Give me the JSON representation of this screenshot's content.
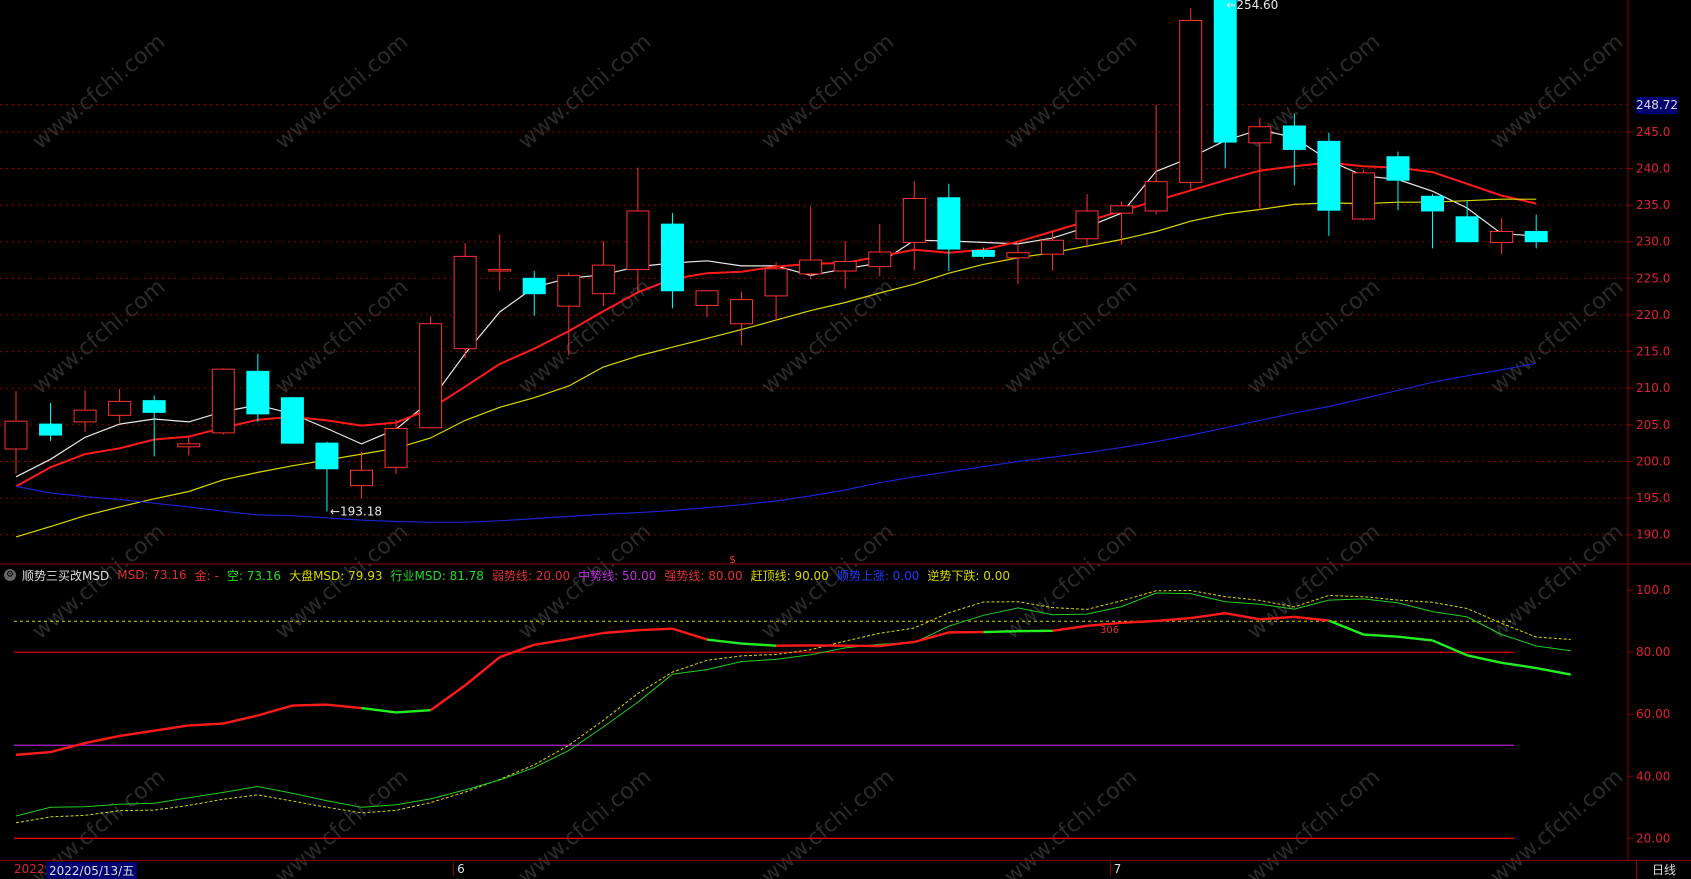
{
  "chart_data": [
    {
      "type": "candlestick",
      "panel": "main-price",
      "ylim": [
        186,
        263
      ],
      "yticks": [
        "190.0",
        "195.0",
        "200.0",
        "205.0",
        "210.0",
        "215.0",
        "220.0",
        "225.0",
        "230.0",
        "235.0",
        "240.0",
        "245.0"
      ],
      "current_price": "248.72",
      "high_annotation": "254.60",
      "low_annotation": "193.18",
      "candles": [
        {
          "o": 201.7,
          "h": 209.6,
          "l": 198.3,
          "c": 205.5
        },
        {
          "o": 205.1,
          "h": 208.0,
          "l": 202.8,
          "c": 203.6
        },
        {
          "o": 205.4,
          "h": 209.7,
          "l": 204.0,
          "c": 207.0
        },
        {
          "o": 206.3,
          "h": 209.9,
          "l": 205.3,
          "c": 208.2
        },
        {
          "o": 208.3,
          "h": 209.0,
          "l": 200.7,
          "c": 206.7
        },
        {
          "o": 202.0,
          "h": 203.3,
          "l": 200.8,
          "c": 202.4
        },
        {
          "o": 203.9,
          "h": 212.7,
          "l": 203.7,
          "c": 212.6
        },
        {
          "o": 212.3,
          "h": 214.7,
          "l": 205.4,
          "c": 206.5
        },
        {
          "o": 208.7,
          "h": 208.8,
          "l": 202.4,
          "c": 202.5
        },
        {
          "o": 202.5,
          "h": 202.7,
          "l": 193.18,
          "c": 199.0
        },
        {
          "o": 196.7,
          "h": 201.3,
          "l": 195.0,
          "c": 198.8
        },
        {
          "o": 199.2,
          "h": 205.7,
          "l": 198.3,
          "c": 204.5
        },
        {
          "o": 204.6,
          "h": 219.8,
          "l": 204.5,
          "c": 218.8
        },
        {
          "o": 215.4,
          "h": 229.8,
          "l": 214.1,
          "c": 228.0
        },
        {
          "o": 226.2,
          "h": 231.0,
          "l": 223.3,
          "c": 226.2
        },
        {
          "o": 225.0,
          "h": 226.0,
          "l": 219.9,
          "c": 222.9
        },
        {
          "o": 221.2,
          "h": 225.8,
          "l": 214.5,
          "c": 225.4
        },
        {
          "o": 222.9,
          "h": 230.1,
          "l": 221.2,
          "c": 226.8
        },
        {
          "o": 226.2,
          "h": 240.1,
          "l": 222.9,
          "c": 234.2
        },
        {
          "o": 232.4,
          "h": 233.9,
          "l": 220.9,
          "c": 223.3
        },
        {
          "o": 221.3,
          "h": 223.4,
          "l": 219.7,
          "c": 223.3
        },
        {
          "o": 218.8,
          "h": 223.2,
          "l": 215.9,
          "c": 222.1
        },
        {
          "o": 222.6,
          "h": 227.2,
          "l": 219.2,
          "c": 226.3
        },
        {
          "o": 225.6,
          "h": 234.8,
          "l": 224.9,
          "c": 227.5
        },
        {
          "o": 226.0,
          "h": 230.1,
          "l": 223.6,
          "c": 227.3
        },
        {
          "o": 226.6,
          "h": 232.4,
          "l": 225.3,
          "c": 228.6
        },
        {
          "o": 229.9,
          "h": 238.3,
          "l": 226.1,
          "c": 235.9
        },
        {
          "o": 236.0,
          "h": 237.9,
          "l": 226.0,
          "c": 229.0
        },
        {
          "o": 228.8,
          "h": 229.2,
          "l": 227.7,
          "c": 228.0
        },
        {
          "o": 227.8,
          "h": 229.8,
          "l": 224.2,
          "c": 228.5
        },
        {
          "o": 228.3,
          "h": 231.4,
          "l": 226.1,
          "c": 230.2
        },
        {
          "o": 230.4,
          "h": 236.5,
          "l": 229.2,
          "c": 234.2
        },
        {
          "o": 233.9,
          "h": 235.5,
          "l": 229.6,
          "c": 234.9
        },
        {
          "o": 234.2,
          "h": 248.7,
          "l": 233.7,
          "c": 238.2
        },
        {
          "o": 238.1,
          "h": 261.9,
          "l": 236.9,
          "c": 260.2
        },
        {
          "o": 263.0,
          "h": 263.0,
          "l": 240.1,
          "c": 243.6
        },
        {
          "o": 243.5,
          "h": 246.9,
          "l": 234.3,
          "c": 245.7
        },
        {
          "o": 245.8,
          "h": 247.5,
          "l": 237.7,
          "c": 242.6
        },
        {
          "o": 243.7,
          "h": 244.9,
          "l": 230.8,
          "c": 234.3
        },
        {
          "o": 233.1,
          "h": 239.8,
          "l": 232.9,
          "c": 239.4
        },
        {
          "o": 241.6,
          "h": 242.3,
          "l": 234.3,
          "c": 238.4
        },
        {
          "o": 236.2,
          "h": 236.5,
          "l": 229.1,
          "c": 234.2
        },
        {
          "o": 233.4,
          "h": 235.6,
          "l": 229.9,
          "c": 230.0
        },
        {
          "o": 229.9,
          "h": 233.2,
          "l": 228.3,
          "c": 231.4
        },
        {
          "o": 231.4,
          "h": 233.7,
          "l": 229.1,
          "c": 230.0
        }
      ],
      "series": [
        {
          "name": "MA-white",
          "color": "#e8e8e8",
          "values": [
            197.9,
            200.3,
            203.3,
            205.1,
            205.8,
            205.4,
            206.8,
            207.7,
            206.5,
            204.5,
            202.4,
            204.4,
            208.3,
            214.7,
            220.4,
            223.8,
            225.0,
            225.5,
            226.6,
            227.1,
            227.4,
            226.7,
            226.7,
            225.4,
            226.3,
            227.1,
            230.2,
            230.1,
            229.9,
            229.7,
            230.5,
            232.0,
            233.9,
            239.6,
            241.5,
            243.8,
            245.3,
            244.2,
            241.1,
            239.0,
            238.5,
            236.9,
            234.6,
            231.1,
            230.8
          ]
        },
        {
          "name": "MA-red",
          "color": "#ff1a1a",
          "values": [
            196.6,
            199.2,
            201.0,
            201.8,
            203.0,
            203.4,
            204.6,
            205.7,
            206.1,
            205.6,
            204.9,
            205.3,
            207.2,
            210.2,
            213.3,
            215.4,
            217.8,
            220.5,
            223.1,
            224.9,
            225.7,
            225.9,
            226.6,
            227.0,
            227.1,
            228.0,
            228.9,
            228.5,
            228.9,
            230.0,
            231.4,
            232.8,
            234.2,
            235.6,
            237.0,
            238.4,
            239.7,
            240.3,
            240.8,
            240.3,
            240.1,
            239.5,
            237.9,
            236.3,
            235.2
          ]
        },
        {
          "name": "MA-yellow",
          "color": "#d8d800",
          "values": [
            189.7,
            191.1,
            192.6,
            193.8,
            194.9,
            195.9,
            197.5,
            198.5,
            199.4,
            200.2,
            201.0,
            201.8,
            203.2,
            205.6,
            207.4,
            208.7,
            210.3,
            212.9,
            214.4,
            215.6,
            216.8,
            218.0,
            219.3,
            220.6,
            221.7,
            223.0,
            224.2,
            225.7,
            226.9,
            227.8,
            228.5,
            229.4,
            230.3,
            231.4,
            232.8,
            233.8,
            234.4,
            235.1,
            235.3,
            235.2,
            235.4,
            235.4,
            235.6,
            235.8,
            235.8
          ]
        },
        {
          "name": "MA-blue",
          "color": "#1a22cc",
          "values": [
            196.6,
            195.7,
            195.2,
            194.8,
            194.3,
            193.8,
            193.2,
            192.7,
            192.6,
            192.3,
            192.0,
            191.8,
            191.7,
            191.7,
            191.9,
            192.2,
            192.5,
            192.8,
            193.0,
            193.3,
            193.7,
            194.1,
            194.6,
            195.3,
            196.1,
            197.1,
            197.9,
            198.6,
            199.3,
            200.0,
            200.6,
            201.2,
            201.9,
            202.7,
            203.6,
            204.6,
            205.6,
            206.6,
            207.5,
            208.6,
            209.7,
            210.8,
            211.7,
            212.5,
            213.4
          ]
        }
      ]
    },
    {
      "type": "line",
      "panel": "indicator",
      "ylim": [
        13,
        102
      ],
      "yticks": [
        "20.00",
        "40.00",
        "60.00",
        "80.00",
        "100.0"
      ],
      "levels": [
        {
          "value": 20,
          "color": "#e00000"
        },
        {
          "value": 50,
          "color": "#b020d0"
        },
        {
          "value": 80,
          "color": "#e00000"
        },
        {
          "value": 90,
          "color": "#d8d800",
          "dashed": true
        }
      ],
      "msd": [
        46.9,
        47.8,
        50.7,
        53.0,
        54.7,
        56.4,
        57.0,
        59.6,
        62.8,
        63.1,
        62.0,
        60.6,
        61.3,
        69.3,
        78.4,
        82.4,
        84.2,
        86.2,
        87.1,
        87.6,
        84.1,
        82.8,
        82.1,
        82.2,
        82.1,
        82.0,
        83.3,
        86.4,
        86.5,
        86.8,
        86.9,
        88.5,
        89.5,
        90.1,
        91.0,
        92.6,
        90.6,
        91.4,
        90.2,
        85.7,
        85.0,
        83.8,
        79.0,
        76.6,
        74.9,
        72.8
      ],
      "msd_up": [
        1,
        1,
        1,
        1,
        1,
        1,
        1,
        1,
        1,
        1,
        0,
        0,
        1,
        1,
        1,
        1,
        1,
        1,
        1,
        1,
        0,
        0,
        1,
        1,
        1,
        1,
        1,
        1,
        0,
        0,
        1,
        1,
        1,
        1,
        1,
        1,
        1,
        1,
        0,
        0,
        0,
        0,
        0,
        0,
        0,
        0
      ],
      "industry": [
        27.2,
        30.0,
        30.2,
        31.0,
        31.3,
        33.1,
        34.8,
        36.7,
        34.5,
        32.1,
        30.0,
        30.8,
        32.7,
        35.6,
        38.8,
        42.8,
        48.3,
        55.9,
        63.9,
        72.9,
        74.4,
        77.0,
        77.7,
        79.2,
        81.4,
        82.6,
        83.1,
        88.4,
        91.9,
        94.3,
        92.1,
        92.3,
        94.7,
        99.1,
        98.9,
        96.3,
        95.5,
        93.9,
        96.8,
        97.2,
        95.9,
        93.1,
        91.4,
        85.7,
        82.0,
        80.5
      ],
      "market": [
        25.0,
        26.9,
        27.4,
        28.9,
        29.1,
        30.6,
        32.6,
        34.0,
        32.0,
        30.0,
        28.2,
        29.0,
        31.5,
        34.9,
        39.0,
        43.7,
        50.0,
        58.0,
        66.7,
        73.6,
        77.4,
        78.8,
        79.3,
        80.8,
        83.6,
        86.1,
        87.8,
        92.7,
        96.2,
        96.3,
        94.4,
        93.8,
        96.6,
        99.8,
        99.9,
        97.9,
        96.7,
        94.6,
        98.3,
        97.9,
        96.8,
        96.1,
        94.1,
        89.3,
        84.9,
        84.1
      ],
      "marker_text": "306"
    }
  ],
  "indicator": {
    "name": "顺势三买改MSD",
    "items": [
      {
        "text": "MSD: 73.16",
        "color": "#e23030"
      },
      {
        "text": "金: -",
        "color": "#e23030"
      },
      {
        "text": "空: 73.16",
        "color": "#22dd22"
      },
      {
        "text": "大盘MSD: 79.93",
        "color": "#d8d800"
      },
      {
        "text": "行业MSD: 81.78",
        "color": "#22dd22"
      },
      {
        "text": "弱势线: 20.00",
        "color": "#e23030"
      },
      {
        "text": "中势线: 50.00",
        "color": "#c030e0"
      },
      {
        "text": "强势线: 80.00",
        "color": "#e23030"
      },
      {
        "text": "赶顶线: 90.00",
        "color": "#d8d800"
      },
      {
        "text": "顺势上涨: 0.00",
        "color": "#2238ff"
      },
      {
        "text": "逆势下跌: 0.00",
        "color": "#d8d800"
      }
    ]
  },
  "footer": {
    "date": "2022/05/13/五",
    "year_prefix": "2022",
    "months": [
      "6",
      "7"
    ],
    "period": "日线"
  },
  "watermark": "www.cfchi.com",
  "colors": {
    "up": "#ff3030",
    "down": "#00ffff",
    "grid": "#8b0000"
  }
}
